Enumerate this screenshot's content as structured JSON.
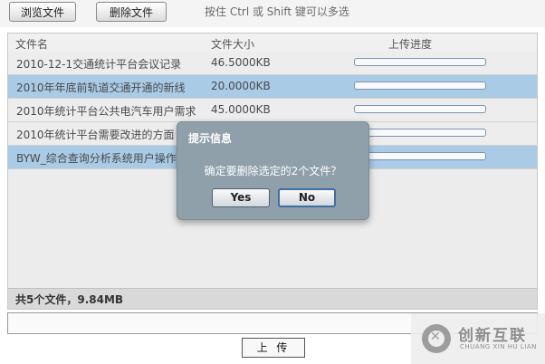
{
  "toolbar": {
    "browse_label": "浏览文件",
    "remove_label": "删除文件",
    "hint": "按住 Ctrl 或 Shift 键可以多选"
  },
  "columns": {
    "name": "文件名",
    "size": "文件大小",
    "progress": "上传进度"
  },
  "files": [
    {
      "name": "2010-12-1交通统计平台会议记录",
      "size": "46.5000KB",
      "progress": 0,
      "selected": false
    },
    {
      "name": "2010年年底前轨道交通开通的新线",
      "size": "20.0000KB",
      "progress": 0,
      "selected": true
    },
    {
      "name": "2010年统计平台公共电汽车用户需求",
      "size": "45.0000KB",
      "progress": 0,
      "selected": false
    },
    {
      "name": "2010年统计平台需要改进的方面",
      "size": "",
      "progress": 0,
      "selected": false
    },
    {
      "name": "BYW_综合查询分析系统用户操作手册",
      "size": "",
      "progress": 0,
      "selected": true
    }
  ],
  "footer": {
    "summary": "共5个文件，9.84MB"
  },
  "upload_label": "上 传",
  "dialog": {
    "title": "提示信息",
    "message": "确定要删除选定的2个文件？",
    "yes_label": "Yes",
    "no_label": "No"
  },
  "watermark": {
    "brand": "创新互联",
    "sub": "CHUANG XIN HU LIAN",
    "icon": "brand-logo-icon"
  },
  "colors": {
    "selected_row": "#a9cbe6",
    "dialog_bg": "#8fa0aa",
    "progress_border": "#7d93b0"
  }
}
